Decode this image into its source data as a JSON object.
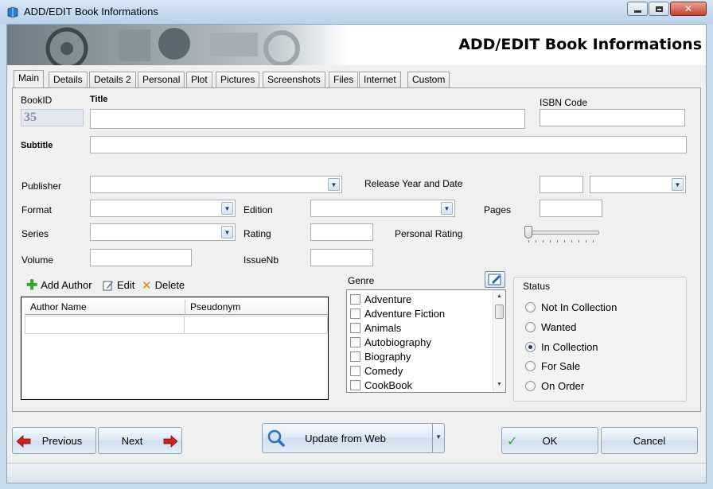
{
  "window": {
    "title": "ADD/EDIT Book Informations"
  },
  "header": {
    "title": "ADD/EDIT Book Informations"
  },
  "tabs": [
    "Main",
    "Details",
    "Details 2",
    "Personal",
    "Plot",
    "Pictures",
    "Screenshots",
    "Files",
    "Internet",
    "Custom"
  ],
  "active_tab": "Main",
  "fields": {
    "bookid_label": "BookID",
    "bookid_value": "35",
    "title_label": "Title",
    "title_value": "",
    "isbn_label": "ISBN Code",
    "isbn_value": "",
    "subtitle_label": "Subtitle",
    "subtitle_value": "",
    "publisher_label": "Publisher",
    "release_label": "Release Year and Date",
    "format_label": "Format",
    "edition_label": "Edition",
    "pages_label": "Pages",
    "series_label": "Series",
    "rating_label": "Rating",
    "personal_rating_label": "Personal Rating",
    "personal_rating_value": 0,
    "volume_label": "Volume",
    "issuenb_label": "IssueNb"
  },
  "authors": {
    "add_label": "Add Author",
    "edit_label": "Edit",
    "delete_label": "Delete",
    "columns": [
      "Author Name",
      "Pseudonym"
    ]
  },
  "genre": {
    "label": "Genre",
    "items": [
      "Adventure",
      "Adventure Fiction",
      "Animals",
      "Autobiography",
      "Biography",
      "Comedy",
      "CookBook"
    ]
  },
  "status": {
    "label": "Status",
    "options": [
      "Not In Collection",
      "Wanted",
      "In Collection",
      "For Sale",
      "On Order"
    ],
    "selected": "In Collection"
  },
  "buttons": {
    "previous": "Previous",
    "next": "Next",
    "update": "Update from Web",
    "ok": "OK",
    "cancel": "Cancel"
  },
  "colors": {
    "accent": "#1f3d6b",
    "ok_green": "#2fa82f",
    "arrow_red": "#d11f1f"
  }
}
